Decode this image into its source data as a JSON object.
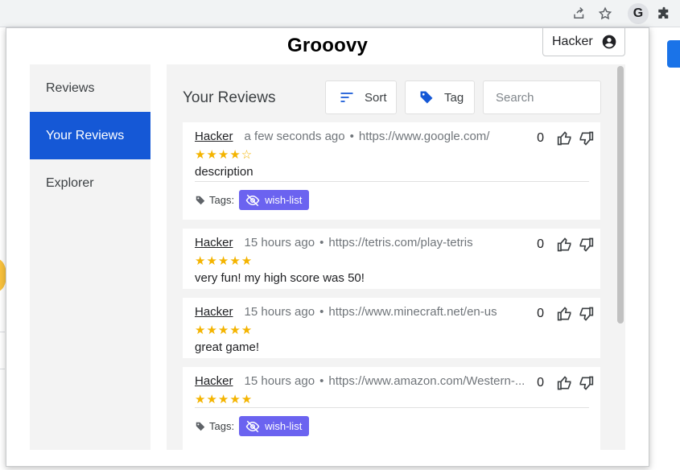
{
  "browser": {
    "icons": [
      "share-icon",
      "star-icon",
      "grooovy-extension-icon",
      "extensions-puzzle-icon"
    ],
    "extension_letter": "G"
  },
  "app": {
    "title": "Grooovy",
    "user": {
      "name": "Hacker",
      "icon": "account-circle-icon"
    }
  },
  "sidebar": {
    "items": [
      {
        "label": "Reviews",
        "active": false
      },
      {
        "label": "Your Reviews",
        "active": true
      },
      {
        "label": "Explorer",
        "active": false
      }
    ]
  },
  "main": {
    "title": "Your Reviews",
    "sort_label": "Sort",
    "tag_label": "Tag",
    "search_placeholder": "Search",
    "reviews": [
      {
        "author": "Hacker",
        "time": "a few seconds ago",
        "url": "https://www.google.com/",
        "stars": "★★★★☆",
        "rating": 4,
        "description": "description",
        "votes": "0",
        "tags_label": "Tags:",
        "tags": [
          "wish-list"
        ]
      },
      {
        "author": "Hacker",
        "time": "15 hours ago",
        "url": "https://tetris.com/play-tetris",
        "stars": "★★★★★",
        "rating": 5,
        "description": "very fun! my high score was 50!",
        "votes": "0"
      },
      {
        "author": "Hacker",
        "time": "15 hours ago",
        "url": "https://www.minecraft.net/en-us",
        "stars": "★★★★★",
        "rating": 5,
        "description": "great game!",
        "votes": "0"
      },
      {
        "author": "Hacker",
        "time": "15 hours ago",
        "url": "https://www.amazon.com/Western-...",
        "stars": "★★★★★",
        "rating": 5,
        "description": "",
        "votes": "0",
        "tags_label": "Tags:",
        "tags": [
          "wish-list"
        ]
      }
    ]
  },
  "colors": {
    "accent": "#1558d6",
    "tag_chip": "#6b63f0",
    "star": "#f4b400"
  }
}
